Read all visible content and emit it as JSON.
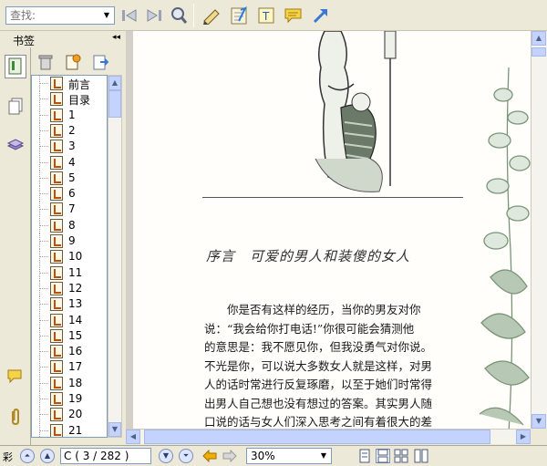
{
  "toolbar": {
    "search_placeholder": "查找:",
    "buttons": [
      "prev-search",
      "next-search",
      "zoom-search",
      "highlight-pen",
      "note-pad",
      "text-tool",
      "comment-tool",
      "arrow-tool"
    ]
  },
  "sidebar": {
    "title": "书签",
    "collapse_glyph": "◂◂",
    "bookmarks": [
      "前言",
      "目录",
      "1",
      "2",
      "3",
      "4",
      "5",
      "6",
      "7",
      "8",
      "9",
      "10",
      "11",
      "12",
      "13",
      "14",
      "15",
      "16",
      "17",
      "18",
      "19",
      "20",
      "21"
    ]
  },
  "document": {
    "title": "序言　可爱的男人和装傻的女人",
    "lines": [
      "　　你是否有这样的经历，当你的男友对你",
      "说：“我会给你打电话!”你很可能会猜测他",
      "的意思是：我不愿见你，但我没勇气对你说。",
      "不光是你，可以说大多数女人就是这样，对男",
      "人的话时常进行反复琢磨，以至于她们时常得",
      "出男人自己想也没有想过的答案。其实男人随",
      "口说的话与女人们深入思考之间有着很大的差"
    ]
  },
  "status": {
    "label": "彩",
    "page": "C ( 3 / 282 )",
    "zoom": "30%"
  },
  "colors": {
    "accent": "#316ac5",
    "chrome": "#ece9d8",
    "scroll": "#c3d3fd"
  }
}
